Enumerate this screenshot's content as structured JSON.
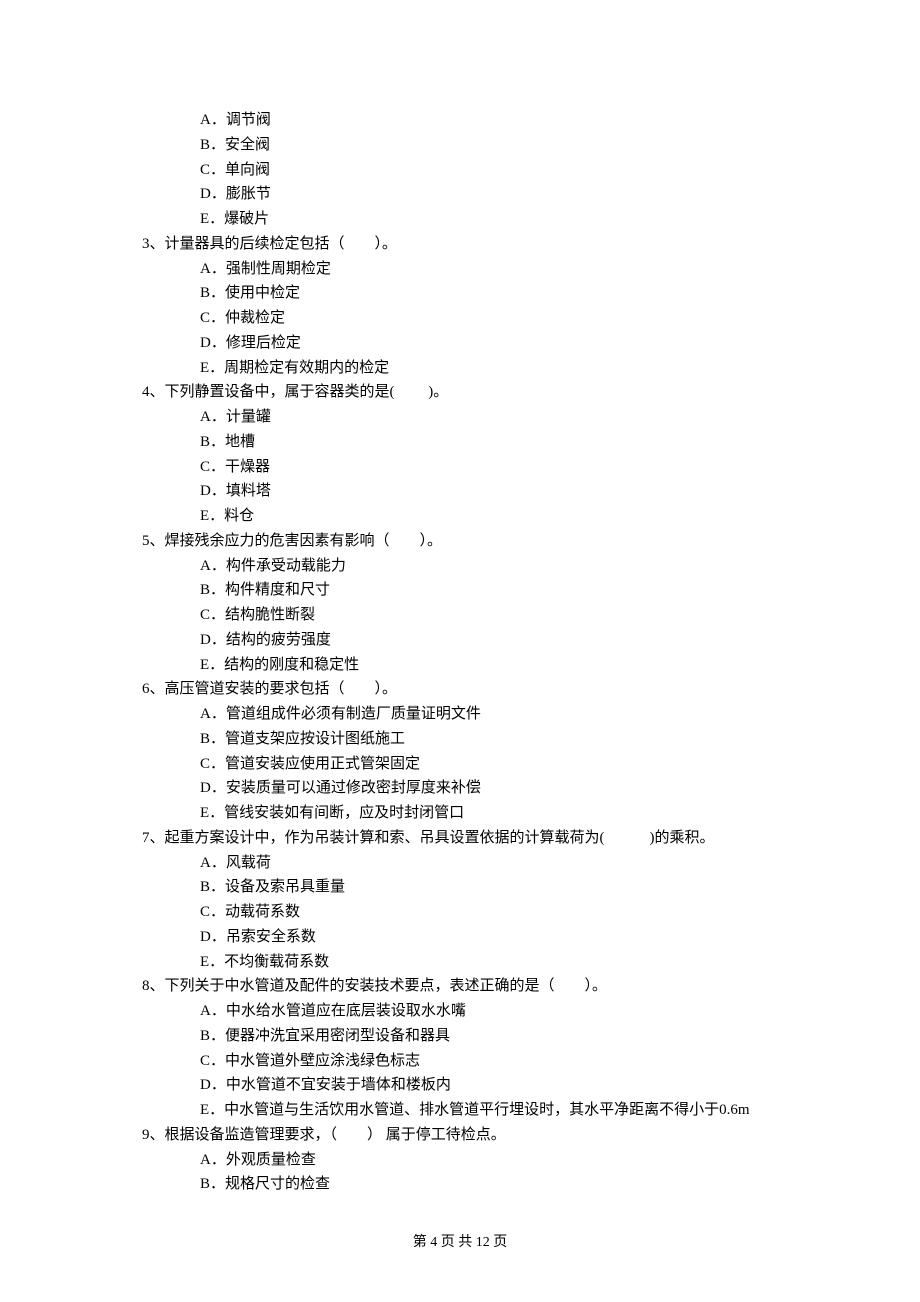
{
  "q2_options": {
    "A": "A．调节阀",
    "B": "B．安全阀",
    "C": "C．单向阀",
    "D": "D．膨胀节",
    "E": "E．爆破片"
  },
  "q3": {
    "stem": "3、计量器具的后续检定包括（　　）。",
    "A": "A．强制性周期检定",
    "B": "B．使用中检定",
    "C": "C．仲裁检定",
    "D": "D．修理后检定",
    "E": "E．周期检定有效期内的检定"
  },
  "q4": {
    "stem": "4、下列静置设备中，属于容器类的是(　　 )。",
    "A": "A．计量罐",
    "B": "B．地槽",
    "C": "C．干燥器",
    "D": "D．填料塔",
    "E": "E．料仓"
  },
  "q5": {
    "stem": "5、焊接残余应力的危害因素有影响（　　）。",
    "A": "A．构件承受动载能力",
    "B": "B．构件精度和尺寸",
    "C": "C．结构脆性断裂",
    "D": "D．结构的疲劳强度",
    "E": "E．结构的刚度和稳定性"
  },
  "q6": {
    "stem": "6、高压管道安装的要求包括（　　）。",
    "A": "A．管道组成件必须有制造厂质量证明文件",
    "B": "B．管道支架应按设计图纸施工",
    "C": "C．管道安装应使用正式管架固定",
    "D": "D．安装质量可以通过修改密封厚度来补偿",
    "E": "E．管线安装如有间断，应及时封闭管口"
  },
  "q7": {
    "stem": "7、起重方案设计中，作为吊装计算和索、吊具设置依据的计算载荷为(　　　)的乘积。",
    "A": "A．风载荷",
    "B": "B．设备及索吊具重量",
    "C": "C．动载荷系数",
    "D": "D．吊索安全系数",
    "E": "E．不均衡载荷系数"
  },
  "q8": {
    "stem": "8、下列关于中水管道及配件的安装技术要点，表述正确的是（　　）。",
    "A": "A．中水给水管道应在底层装设取水水嘴",
    "B": "B．便器冲洗宜采用密闭型设备和器具",
    "C": "C．中水管道外壁应涂浅绿色标志",
    "D": "D．中水管道不宜安装于墙体和楼板内",
    "E": "E．中水管道与生活饮用水管道、排水管道平行埋设时，其水平净距离不得小于0.6m"
  },
  "q9": {
    "stem": "9、根据设备监造管理要求，（　　） 属于停工待检点。",
    "A": "A．外观质量检查",
    "B": "B．规格尺寸的检查"
  },
  "footer": "第 4 页 共 12 页"
}
